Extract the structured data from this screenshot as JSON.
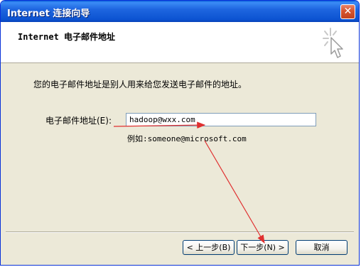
{
  "window": {
    "title": "Internet 连接向导",
    "close_glyph": "✕"
  },
  "header": {
    "title": "Internet 电子邮件地址",
    "icon": "wizard-sparkle-cursor-icon"
  },
  "content": {
    "description": "您的电子邮件地址是别人用来给您发送电子邮件的地址。",
    "email_label": "电子邮件地址(E):",
    "email_value": "hadoop@wxx.com",
    "example": "例如:someone@microsoft.com"
  },
  "buttons": {
    "back": "< 上一步(B)",
    "next": "下一步(N) >",
    "cancel": "取消"
  },
  "annotations": {
    "arrow_color": "#e03030"
  }
}
